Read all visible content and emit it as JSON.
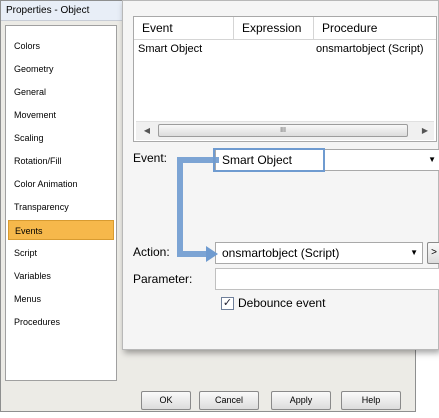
{
  "window": {
    "title": "Properties - Object"
  },
  "sidebar": {
    "items": [
      {
        "label": "Colors"
      },
      {
        "label": "Geometry"
      },
      {
        "label": "General"
      },
      {
        "label": "Movement"
      },
      {
        "label": "Scaling"
      },
      {
        "label": "Rotation/Fill"
      },
      {
        "label": "Color Animation"
      },
      {
        "label": "Transparency"
      },
      {
        "label": "Events",
        "selected": true
      },
      {
        "label": "Script"
      },
      {
        "label": "Variables"
      },
      {
        "label": "Menus"
      },
      {
        "label": "Procedures"
      }
    ]
  },
  "grid": {
    "columns": [
      "Event",
      "Expression",
      "Procedure"
    ],
    "rows": [
      {
        "event": "Smart Object",
        "expression": "",
        "procedure": "onsmartobject (Script)"
      }
    ],
    "scroll_thumb": "III"
  },
  "form": {
    "event_label": "Event:",
    "event_value": "Smart Object",
    "action_label": "Action:",
    "action_value": "onsmartobject (Script)",
    "action_button": ">",
    "parameter_label": "Parameter:",
    "parameter_value": "",
    "debounce_label": "Debounce event",
    "debounce_checked": true
  },
  "footer": {
    "ok": "OK",
    "cancel": "Cancel",
    "apply": "Apply",
    "help": "Help"
  },
  "colors": {
    "selection": "#f6b84b",
    "arrow": "#6f9bd0"
  },
  "icons": {
    "dropdown": "chevron-down-icon",
    "check": "checkmark-icon",
    "scroll_left": "arrow-left-icon",
    "scroll_right": "arrow-right-icon"
  }
}
